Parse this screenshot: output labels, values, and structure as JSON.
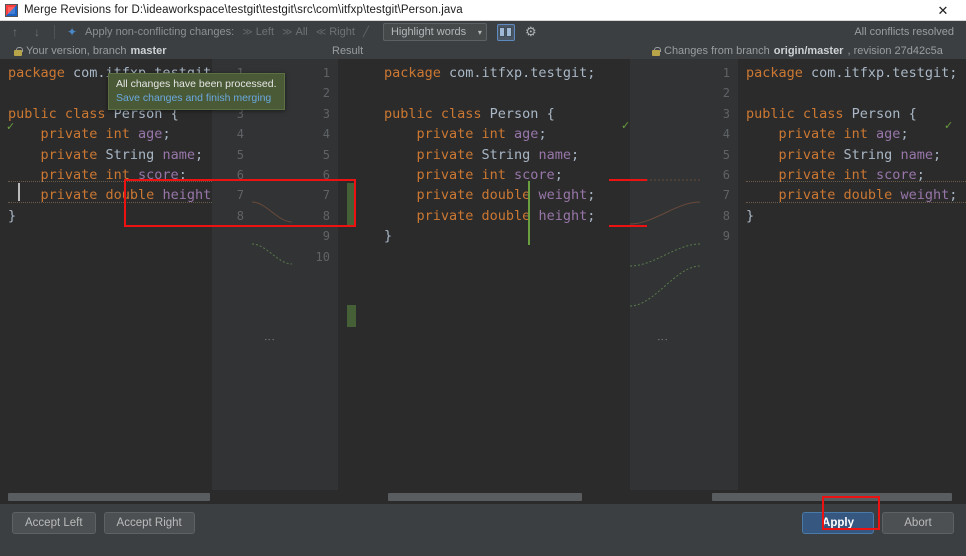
{
  "window": {
    "title": "Merge Revisions for D:\\ideaworkspace\\testgit\\testgit\\src\\com\\itfxp\\testgit\\Person.java",
    "app_icon": "intellij-idea-icon",
    "close_label": "✕"
  },
  "toolbar": {
    "prev_icon": "↑",
    "next_icon": "↓",
    "apply_all_icon": "✦",
    "apply_label": "Apply non-conflicting changes:",
    "actions": [
      {
        "name": "left",
        "glyph": "≫",
        "label": "Left"
      },
      {
        "name": "all",
        "glyph": "≫",
        "label": "All"
      },
      {
        "name": "right",
        "glyph": "≪",
        "label": "Right"
      },
      {
        "name": "magic",
        "glyph": "╱",
        "label": ""
      }
    ],
    "highlight_mode": "Highlight words",
    "caret": "▾",
    "split_toggle_icon": "split-view-icon",
    "settings_icon": "⚙",
    "conflicts_status": "All conflicts resolved"
  },
  "captions": {
    "left": {
      "lock_icon": "lock-icon",
      "prefix": "Your version, branch ",
      "branch": "master",
      "suffix": ""
    },
    "center": {
      "label": "Result"
    },
    "right": {
      "lock_icon": "lock-icon",
      "prefix": "Changes from branch ",
      "branch": "origin/master",
      "suffix": ", revision 27d42c5a"
    }
  },
  "left_pane": {
    "name": "local-version-editor",
    "line_numbers": [
      "1",
      "2",
      "3",
      "4",
      "5",
      "6",
      "7",
      "8"
    ],
    "lines": [
      [
        {
          "t": "package ",
          "c": "kw"
        },
        {
          "t": "com.itfxp.testgit",
          "c": "pl"
        }
      ],
      [],
      [
        {
          "t": "public class ",
          "c": "kw"
        },
        {
          "t": "Person",
          "c": "ty"
        },
        {
          "t": " {",
          "c": "pl"
        }
      ],
      [
        {
          "t": "    private int ",
          "c": "kw"
        },
        {
          "t": "age",
          "c": "fld"
        },
        {
          "t": ";",
          "c": "pl"
        }
      ],
      [
        {
          "t": "    private ",
          "c": "kw"
        },
        {
          "t": "String ",
          "c": "ty"
        },
        {
          "t": "name",
          "c": "fld"
        },
        {
          "t": ";",
          "c": "pl"
        }
      ],
      [
        {
          "t": "    private int ",
          "c": "kw"
        },
        {
          "t": "score",
          "c": "fld"
        },
        {
          "t": ";",
          "c": "pl"
        }
      ],
      [
        {
          "t": "    private double ",
          "c": "kw"
        },
        {
          "t": "height",
          "c": "fld"
        }
      ],
      [
        {
          "t": "}",
          "c": "pl"
        }
      ]
    ]
  },
  "center_pane": {
    "name": "merge-result-editor",
    "line_numbers_left": [
      "1",
      "2",
      "3",
      "4",
      "5",
      "6",
      "7",
      "8"
    ],
    "line_numbers_right": [
      "1",
      "2",
      "3",
      "4",
      "5",
      "6",
      "7",
      "8",
      "9",
      "10"
    ],
    "lines": [
      [
        {
          "t": "package ",
          "c": "kw"
        },
        {
          "t": "com.itfxp.testgit",
          "c": "pl"
        },
        {
          "t": ";",
          "c": "pl"
        }
      ],
      [],
      [
        {
          "t": "public class ",
          "c": "kw"
        },
        {
          "t": "Person",
          "c": "ty"
        },
        {
          "t": " {",
          "c": "pl"
        }
      ],
      [
        {
          "t": "    private int ",
          "c": "kw"
        },
        {
          "t": "age",
          "c": "fld"
        },
        {
          "t": ";",
          "c": "pl"
        }
      ],
      [
        {
          "t": "    private ",
          "c": "kw"
        },
        {
          "t": "String ",
          "c": "ty"
        },
        {
          "t": "name",
          "c": "fld"
        },
        {
          "t": ";",
          "c": "pl"
        }
      ],
      [
        {
          "t": "    private int ",
          "c": "kw"
        },
        {
          "t": "score",
          "c": "fld"
        },
        {
          "t": ";",
          "c": "pl"
        }
      ],
      [
        {
          "t": "    private double ",
          "c": "kw"
        },
        {
          "t": "weight",
          "c": "fld"
        },
        {
          "t": ";",
          "c": "pl"
        }
      ],
      [
        {
          "t": "    private double ",
          "c": "kw"
        },
        {
          "t": "height",
          "c": "fld"
        },
        {
          "t": ";",
          "c": "pl"
        }
      ],
      [
        {
          "t": "}",
          "c": "pl"
        }
      ],
      []
    ]
  },
  "right_pane": {
    "name": "remote-version-editor",
    "line_numbers": [
      "1",
      "2",
      "3",
      "4",
      "5",
      "6",
      "7",
      "8",
      "9"
    ],
    "lines": [
      [
        {
          "t": "package ",
          "c": "kw"
        },
        {
          "t": "com.itfxp.testgit",
          "c": "pl"
        },
        {
          "t": ";",
          "c": "pl"
        }
      ],
      [],
      [
        {
          "t": "public class ",
          "c": "kw"
        },
        {
          "t": "Person",
          "c": "ty"
        },
        {
          "t": " {",
          "c": "pl"
        }
      ],
      [
        {
          "t": "    private int ",
          "c": "kw"
        },
        {
          "t": "age",
          "c": "fld"
        },
        {
          "t": ";",
          "c": "pl"
        }
      ],
      [
        {
          "t": "    private ",
          "c": "kw"
        },
        {
          "t": "String ",
          "c": "ty"
        },
        {
          "t": "name",
          "c": "fld"
        },
        {
          "t": ";",
          "c": "pl"
        }
      ],
      [
        {
          "t": "    private int ",
          "c": "kw"
        },
        {
          "t": "score",
          "c": "fld"
        },
        {
          "t": ";",
          "c": "pl"
        }
      ],
      [
        {
          "t": "    private double ",
          "c": "kw"
        },
        {
          "t": "weight",
          "c": "fld"
        },
        {
          "t": ";",
          "c": "pl"
        }
      ],
      [
        {
          "t": "}",
          "c": "pl"
        }
      ],
      []
    ]
  },
  "tooltip": {
    "line1": "All changes have been processed.",
    "line2": "Save changes and finish merging"
  },
  "buttons": {
    "accept_left": "Accept Left",
    "accept_right": "Accept Right",
    "apply": "Apply",
    "abort": "Abort"
  },
  "colors": {
    "keyword": "#cc7832",
    "field": "#9876aa",
    "text": "#a9b7c6",
    "editor_bg": "#2b2b2b",
    "chrome_bg": "#3c3f41",
    "accent_primary": "#365880",
    "annotation": "#ee1111",
    "change_band": "#4a6a3a",
    "tooltip_bg": "#4a5a36"
  }
}
